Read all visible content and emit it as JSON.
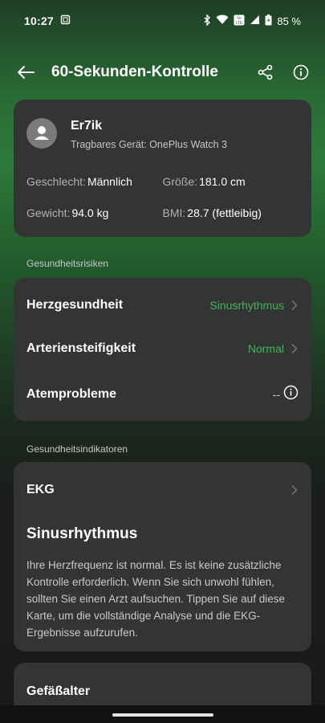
{
  "status_bar": {
    "time": "10:27",
    "battery": "85 %",
    "icons": [
      "screenshot-icon",
      "bluetooth-icon",
      "wifi-icon",
      "volte-icon",
      "signal-icon",
      "battery-icon"
    ]
  },
  "app_bar": {
    "title": "60-Sekunden-Kontrolle"
  },
  "profile": {
    "name": "Er7ik",
    "device": "Tragbares Gerät: OnePlus Watch 3",
    "fields": [
      {
        "label": "Geschlecht:",
        "value": "Männlich"
      },
      {
        "label": "Größe:",
        "value": "181.0 cm"
      },
      {
        "label": "Gewicht:",
        "value": "94.0 kg"
      },
      {
        "label": "BMI:",
        "value": "28.7 (fettleibig)"
      }
    ]
  },
  "risks": {
    "header": "Gesundheitsrisiken",
    "items": [
      {
        "label": "Herzgesundheit",
        "value": "Sinusrhythmus"
      },
      {
        "label": "Arteriensteifigkeit",
        "value": "Normal"
      },
      {
        "label": "Atemprobleme",
        "value": "--"
      }
    ]
  },
  "indicators": {
    "header": "Gesundheitsindikatoren",
    "ekg": {
      "title": "EKG",
      "status": "Sinusrhythmus",
      "description": "Ihre Herzfrequenz ist normal. Es ist keine zusätzliche Kontrolle erforderlich. Wenn Sie sich unwohl fühlen, sollten Sie einen Arzt aufsuchen. Tippen Sie auf diese Karte, um die vollständige Analyse und die EKG-Ergebnisse aufzurufen."
    },
    "vessel": {
      "title": "Gefäßalter"
    }
  },
  "colors": {
    "accent_green": "#43b35b",
    "card": "#333535"
  }
}
